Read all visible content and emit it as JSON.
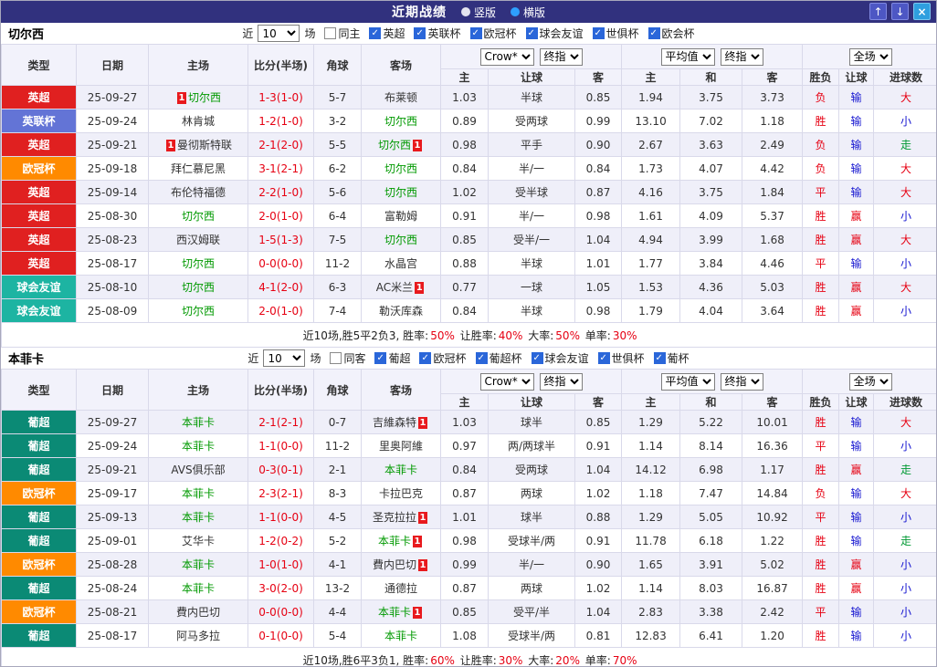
{
  "titlebar": {
    "title": "近期战绩",
    "radios": [
      {
        "label": "竖版",
        "selected": false
      },
      {
        "label": "横版",
        "selected": true
      }
    ],
    "buttons": [
      {
        "name": "up",
        "glyph": "↑"
      },
      {
        "name": "down",
        "glyph": "↓"
      },
      {
        "name": "close",
        "glyph": "×"
      }
    ]
  },
  "header_labels": {
    "fixed": [
      "类型",
      "日期",
      "主场",
      "比分(半场)",
      "角球",
      "客场"
    ],
    "sub": [
      "主",
      "让球",
      "客",
      "主",
      "和",
      "客",
      "胜负",
      "让球",
      "进球数"
    ],
    "asian_source": "Crow*",
    "asian_stage": "终指",
    "euro_source": "平均值",
    "euro_stage": "终指",
    "scope": "全场"
  },
  "league_colors": {
    "英超": "#e02020",
    "英联杯": "#6374d6",
    "欧冠杯": "#ff8a00",
    "球会友谊": "#1db4a2",
    "葡超": "#0b8a75"
  },
  "sections": [
    {
      "team": "切尔西",
      "filter": {
        "near": "近",
        "count": "10",
        "games": "场",
        "same": {
          "label": "同主",
          "checked": false
        },
        "leagues": [
          {
            "label": "英超",
            "checked": true
          },
          {
            "label": "英联杯",
            "checked": true
          },
          {
            "label": "欧冠杯",
            "checked": true
          },
          {
            "label": "球会友谊",
            "checked": true
          },
          {
            "label": "世俱杯",
            "checked": true
          },
          {
            "label": "欧会杯",
            "checked": true
          }
        ]
      },
      "rows": [
        {
          "league": "英超",
          "date": "25-09-27",
          "home": {
            "name": "切尔西",
            "focus": true,
            "card": true
          },
          "score": "1-3(1-0)",
          "corners": "5-7",
          "away": {
            "name": "布莱顿",
            "focus": false,
            "card": false
          },
          "asian": [
            "1.03",
            "半球",
            "0.85"
          ],
          "euro": [
            "1.94",
            "3.75",
            "3.73"
          ],
          "results": [
            [
              "负",
              "red"
            ],
            [
              "输",
              "blue"
            ],
            [
              "大",
              "red"
            ]
          ]
        },
        {
          "league": "英联杯",
          "date": "25-09-24",
          "home": {
            "name": "林肯城",
            "focus": false,
            "card": false
          },
          "score": "1-2(1-0)",
          "corners": "3-2",
          "away": {
            "name": "切尔西",
            "focus": true,
            "card": false
          },
          "asian": [
            "0.89",
            "受两球",
            "0.99"
          ],
          "euro": [
            "13.10",
            "7.02",
            "1.18"
          ],
          "results": [
            [
              "胜",
              "red"
            ],
            [
              "输",
              "blue"
            ],
            [
              "小",
              "blue"
            ]
          ]
        },
        {
          "league": "英超",
          "date": "25-09-21",
          "home": {
            "name": "曼彻斯特联",
            "focus": false,
            "card": true
          },
          "score": "2-1(2-0)",
          "corners": "5-5",
          "away": {
            "name": "切尔西",
            "focus": true,
            "card": true
          },
          "asian": [
            "0.98",
            "平手",
            "0.90"
          ],
          "euro": [
            "2.67",
            "3.63",
            "2.49"
          ],
          "results": [
            [
              "负",
              "red"
            ],
            [
              "输",
              "blue"
            ],
            [
              "走",
              "green"
            ]
          ]
        },
        {
          "league": "欧冠杯",
          "date": "25-09-18",
          "home": {
            "name": "拜仁慕尼黑",
            "focus": false,
            "card": false
          },
          "score": "3-1(2-1)",
          "corners": "6-2",
          "away": {
            "name": "切尔西",
            "focus": true,
            "card": false
          },
          "asian": [
            "0.84",
            "半/一",
            "0.84"
          ],
          "euro": [
            "1.73",
            "4.07",
            "4.42"
          ],
          "results": [
            [
              "负",
              "red"
            ],
            [
              "输",
              "blue"
            ],
            [
              "大",
              "red"
            ]
          ]
        },
        {
          "league": "英超",
          "date": "25-09-14",
          "home": {
            "name": "布伦特福德",
            "focus": false,
            "card": false
          },
          "score": "2-2(1-0)",
          "corners": "5-6",
          "away": {
            "name": "切尔西",
            "focus": true,
            "card": false
          },
          "asian": [
            "1.02",
            "受半球",
            "0.87"
          ],
          "euro": [
            "4.16",
            "3.75",
            "1.84"
          ],
          "results": [
            [
              "平",
              "red"
            ],
            [
              "输",
              "blue"
            ],
            [
              "大",
              "red"
            ]
          ]
        },
        {
          "league": "英超",
          "date": "25-08-30",
          "home": {
            "name": "切尔西",
            "focus": true,
            "card": false
          },
          "score": "2-0(1-0)",
          "corners": "6-4",
          "away": {
            "name": "富勒姆",
            "focus": false,
            "card": false
          },
          "asian": [
            "0.91",
            "半/一",
            "0.98"
          ],
          "euro": [
            "1.61",
            "4.09",
            "5.37"
          ],
          "results": [
            [
              "胜",
              "red"
            ],
            [
              "赢",
              "red"
            ],
            [
              "小",
              "blue"
            ]
          ]
        },
        {
          "league": "英超",
          "date": "25-08-23",
          "home": {
            "name": "西汉姆联",
            "focus": false,
            "card": false
          },
          "score": "1-5(1-3)",
          "corners": "7-5",
          "away": {
            "name": "切尔西",
            "focus": true,
            "card": false
          },
          "asian": [
            "0.85",
            "受半/一",
            "1.04"
          ],
          "euro": [
            "4.94",
            "3.99",
            "1.68"
          ],
          "results": [
            [
              "胜",
              "red"
            ],
            [
              "赢",
              "red"
            ],
            [
              "大",
              "red"
            ]
          ]
        },
        {
          "league": "英超",
          "date": "25-08-17",
          "home": {
            "name": "切尔西",
            "focus": true,
            "card": false
          },
          "score": "0-0(0-0)",
          "corners": "11-2",
          "away": {
            "name": "水晶宫",
            "focus": false,
            "card": false
          },
          "asian": [
            "0.88",
            "半球",
            "1.01"
          ],
          "euro": [
            "1.77",
            "3.84",
            "4.46"
          ],
          "results": [
            [
              "平",
              "red"
            ],
            [
              "输",
              "blue"
            ],
            [
              "小",
              "blue"
            ]
          ]
        },
        {
          "league": "球会友谊",
          "date": "25-08-10",
          "home": {
            "name": "切尔西",
            "focus": true,
            "card": false
          },
          "score": "4-1(2-0)",
          "corners": "6-3",
          "away": {
            "name": "AC米兰",
            "focus": false,
            "card": true
          },
          "asian": [
            "0.77",
            "一球",
            "1.05"
          ],
          "euro": [
            "1.53",
            "4.36",
            "5.03"
          ],
          "results": [
            [
              "胜",
              "red"
            ],
            [
              "赢",
              "red"
            ],
            [
              "大",
              "red"
            ]
          ]
        },
        {
          "league": "球会友谊",
          "date": "25-08-09",
          "home": {
            "name": "切尔西",
            "focus": true,
            "card": false
          },
          "score": "2-0(1-0)",
          "corners": "7-4",
          "away": {
            "name": "勒沃库森",
            "focus": false,
            "card": false
          },
          "asian": [
            "0.84",
            "半球",
            "0.98"
          ],
          "euro": [
            "1.79",
            "4.04",
            "3.64"
          ],
          "results": [
            [
              "胜",
              "red"
            ],
            [
              "赢",
              "red"
            ],
            [
              "小",
              "blue"
            ]
          ]
        }
      ],
      "summary": [
        [
          "近10场,胜5平2负3, 胜率:",
          "black"
        ],
        [
          "50%",
          "red"
        ],
        [
          " 让胜率:",
          "black"
        ],
        [
          "40%",
          "red"
        ],
        [
          " 大率:",
          "black"
        ],
        [
          "50%",
          "red"
        ],
        [
          " 单率:",
          "black"
        ],
        [
          "30%",
          "red"
        ]
      ]
    },
    {
      "team": "本菲卡",
      "filter": {
        "near": "近",
        "count": "10",
        "games": "场",
        "same": {
          "label": "同客",
          "checked": false
        },
        "leagues": [
          {
            "label": "葡超",
            "checked": true
          },
          {
            "label": "欧冠杯",
            "checked": true
          },
          {
            "label": "葡超杯",
            "checked": true
          },
          {
            "label": "球会友谊",
            "checked": true
          },
          {
            "label": "世俱杯",
            "checked": true
          },
          {
            "label": "葡杯",
            "checked": true
          }
        ]
      },
      "rows": [
        {
          "league": "葡超",
          "date": "25-09-27",
          "home": {
            "name": "本菲卡",
            "focus": true,
            "card": false
          },
          "score": "2-1(2-1)",
          "corners": "0-7",
          "away": {
            "name": "吉維森特",
            "focus": false,
            "card": true
          },
          "asian": [
            "1.03",
            "球半",
            "0.85"
          ],
          "euro": [
            "1.29",
            "5.22",
            "10.01"
          ],
          "results": [
            [
              "胜",
              "red"
            ],
            [
              "输",
              "blue"
            ],
            [
              "大",
              "red"
            ]
          ]
        },
        {
          "league": "葡超",
          "date": "25-09-24",
          "home": {
            "name": "本菲卡",
            "focus": true,
            "card": false
          },
          "score": "1-1(0-0)",
          "corners": "11-2",
          "away": {
            "name": "里奥阿維",
            "focus": false,
            "card": false
          },
          "asian": [
            "0.97",
            "两/两球半",
            "0.91"
          ],
          "euro": [
            "1.14",
            "8.14",
            "16.36"
          ],
          "results": [
            [
              "平",
              "red"
            ],
            [
              "输",
              "blue"
            ],
            [
              "小",
              "blue"
            ]
          ]
        },
        {
          "league": "葡超",
          "date": "25-09-21",
          "home": {
            "name": "AVS俱乐部",
            "focus": false,
            "card": false
          },
          "score": "0-3(0-1)",
          "corners": "2-1",
          "away": {
            "name": "本菲卡",
            "focus": true,
            "card": false
          },
          "asian": [
            "0.84",
            "受两球",
            "1.04"
          ],
          "euro": [
            "14.12",
            "6.98",
            "1.17"
          ],
          "results": [
            [
              "胜",
              "red"
            ],
            [
              "赢",
              "red"
            ],
            [
              "走",
              "green"
            ]
          ]
        },
        {
          "league": "欧冠杯",
          "date": "25-09-17",
          "home": {
            "name": "本菲卡",
            "focus": true,
            "card": false
          },
          "score": "2-3(2-1)",
          "corners": "8-3",
          "away": {
            "name": "卡拉巴克",
            "focus": false,
            "card": false
          },
          "asian": [
            "0.87",
            "两球",
            "1.02"
          ],
          "euro": [
            "1.18",
            "7.47",
            "14.84"
          ],
          "results": [
            [
              "负",
              "red"
            ],
            [
              "输",
              "blue"
            ],
            [
              "大",
              "red"
            ]
          ]
        },
        {
          "league": "葡超",
          "date": "25-09-13",
          "home": {
            "name": "本菲卡",
            "focus": true,
            "card": false
          },
          "score": "1-1(0-0)",
          "corners": "4-5",
          "away": {
            "name": "圣克拉拉",
            "focus": false,
            "card": true
          },
          "asian": [
            "1.01",
            "球半",
            "0.88"
          ],
          "euro": [
            "1.29",
            "5.05",
            "10.92"
          ],
          "results": [
            [
              "平",
              "red"
            ],
            [
              "输",
              "blue"
            ],
            [
              "小",
              "blue"
            ]
          ]
        },
        {
          "league": "葡超",
          "date": "25-09-01",
          "home": {
            "name": "艾华卡",
            "focus": false,
            "card": false
          },
          "score": "1-2(0-2)",
          "corners": "5-2",
          "away": {
            "name": "本菲卡",
            "focus": true,
            "card": true
          },
          "asian": [
            "0.98",
            "受球半/两",
            "0.91"
          ],
          "euro": [
            "11.78",
            "6.18",
            "1.22"
          ],
          "results": [
            [
              "胜",
              "red"
            ],
            [
              "输",
              "blue"
            ],
            [
              "走",
              "green"
            ]
          ]
        },
        {
          "league": "欧冠杯",
          "date": "25-08-28",
          "home": {
            "name": "本菲卡",
            "focus": true,
            "card": false
          },
          "score": "1-0(1-0)",
          "corners": "4-1",
          "away": {
            "name": "費内巴切",
            "focus": false,
            "card": true
          },
          "asian": [
            "0.99",
            "半/一",
            "0.90"
          ],
          "euro": [
            "1.65",
            "3.91",
            "5.02"
          ],
          "results": [
            [
              "胜",
              "red"
            ],
            [
              "赢",
              "red"
            ],
            [
              "小",
              "blue"
            ]
          ]
        },
        {
          "league": "葡超",
          "date": "25-08-24",
          "home": {
            "name": "本菲卡",
            "focus": true,
            "card": false
          },
          "score": "3-0(2-0)",
          "corners": "13-2",
          "away": {
            "name": "通德拉",
            "focus": false,
            "card": false
          },
          "asian": [
            "0.87",
            "两球",
            "1.02"
          ],
          "euro": [
            "1.14",
            "8.03",
            "16.87"
          ],
          "results": [
            [
              "胜",
              "red"
            ],
            [
              "赢",
              "red"
            ],
            [
              "小",
              "blue"
            ]
          ]
        },
        {
          "league": "欧冠杯",
          "date": "25-08-21",
          "home": {
            "name": "費内巴切",
            "focus": false,
            "card": false
          },
          "score": "0-0(0-0)",
          "corners": "4-4",
          "away": {
            "name": "本菲卡",
            "focus": true,
            "card": true
          },
          "asian": [
            "0.85",
            "受平/半",
            "1.04"
          ],
          "euro": [
            "2.83",
            "3.38",
            "2.42"
          ],
          "results": [
            [
              "平",
              "red"
            ],
            [
              "输",
              "blue"
            ],
            [
              "小",
              "blue"
            ]
          ]
        },
        {
          "league": "葡超",
          "date": "25-08-17",
          "home": {
            "name": "阿马多拉",
            "focus": false,
            "card": false
          },
          "score": "0-1(0-0)",
          "corners": "5-4",
          "away": {
            "name": "本菲卡",
            "focus": true,
            "card": false
          },
          "asian": [
            "1.08",
            "受球半/两",
            "0.81"
          ],
          "euro": [
            "12.83",
            "6.41",
            "1.20"
          ],
          "results": [
            [
              "胜",
              "red"
            ],
            [
              "输",
              "blue"
            ],
            [
              "小",
              "blue"
            ]
          ]
        }
      ],
      "summary": [
        [
          "近10场,胜6平3负1, 胜率:",
          "black"
        ],
        [
          "60%",
          "red"
        ],
        [
          " 让胜率:",
          "black"
        ],
        [
          "30%",
          "red"
        ],
        [
          " 大率:",
          "black"
        ],
        [
          "20%",
          "red"
        ],
        [
          " 单率:",
          "black"
        ],
        [
          "70%",
          "red"
        ]
      ]
    }
  ]
}
